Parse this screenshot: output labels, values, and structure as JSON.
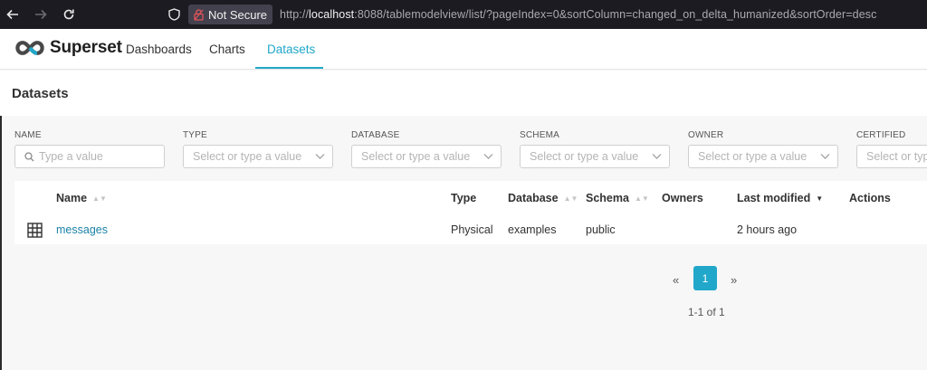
{
  "browser": {
    "security_label": "Not Secure",
    "url_prefix": "http://",
    "url_host": "localhost",
    "url_rest": ":8088/tablemodelview/list/?pageIndex=0&sortColumn=changed_on_delta_humanized&sortOrder=desc"
  },
  "header": {
    "brand": "Superset",
    "nav": [
      {
        "label": "Dashboards"
      },
      {
        "label": "Charts"
      },
      {
        "label": "Datasets"
      }
    ],
    "active_tab": "Datasets",
    "accent_color": "#20a7c9"
  },
  "page": {
    "title": "Datasets"
  },
  "filters": [
    {
      "label": "NAME",
      "placeholder": "Type a value"
    },
    {
      "label": "TYPE",
      "placeholder": "Select or type a value"
    },
    {
      "label": "DATABASE",
      "placeholder": "Select or type a value"
    },
    {
      "label": "SCHEMA",
      "placeholder": "Select or type a value"
    },
    {
      "label": "OWNER",
      "placeholder": "Select or type a value"
    },
    {
      "label": "CERTIFIED",
      "placeholder": "Select or type a value"
    }
  ],
  "table": {
    "columns": [
      {
        "label": "Name",
        "sortable": true
      },
      {
        "label": "Type",
        "sortable": false
      },
      {
        "label": "Database",
        "sortable": true
      },
      {
        "label": "Schema",
        "sortable": true
      },
      {
        "label": "Owners",
        "sortable": false
      },
      {
        "label": "Last modified",
        "sortable": true,
        "sorted": "desc"
      },
      {
        "label": "Actions",
        "sortable": false
      }
    ],
    "rows": [
      {
        "icon": "table-grid-icon",
        "name": "messages",
        "type": "Physical",
        "database": "examples",
        "schema": "public",
        "owners": "",
        "last_modified": "2 hours ago"
      }
    ]
  },
  "pagination": {
    "prev": "«",
    "current_page": "1",
    "next": "»",
    "summary": "1-1 of 1"
  }
}
